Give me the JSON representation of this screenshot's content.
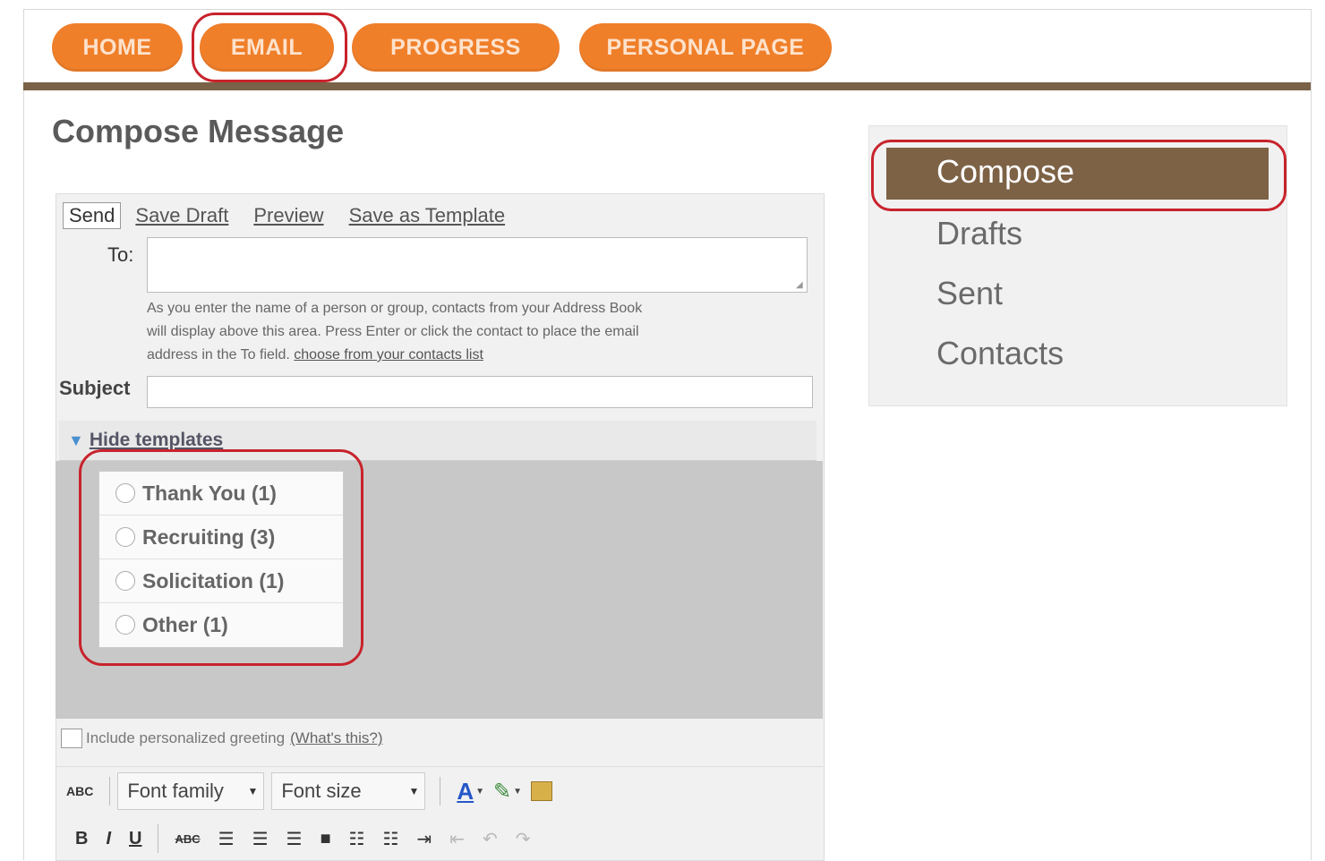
{
  "nav": {
    "tabs": [
      {
        "label": "HOME"
      },
      {
        "label": "EMAIL"
      },
      {
        "label": "PROGRESS"
      },
      {
        "label": "PERSONAL PAGE"
      }
    ]
  },
  "page": {
    "title": "Compose Message"
  },
  "compose": {
    "send": "Send",
    "save_draft": "Save Draft",
    "preview": "Preview",
    "save_template": "Save as Template",
    "to_label": "To:",
    "to_value": "",
    "help_line1": "As you enter the name of a person or group, contacts from your Address Book",
    "help_line2": "will display above this area. Press Enter or click the contact to place the email",
    "help_line3": "address in the To field.",
    "help_link": "choose from your contacts list",
    "subject_label": "Subject",
    "subject_value": ""
  },
  "templates": {
    "toggle": "Hide templates",
    "items": [
      {
        "label": "Thank You (1)"
      },
      {
        "label": "Recruiting (3)"
      },
      {
        "label": "Solicitation (1)"
      },
      {
        "label": "Other (1)"
      }
    ]
  },
  "greeting": {
    "label": "Include personalized greeting",
    "link": "(What's this?)"
  },
  "editor": {
    "spell": "ABC",
    "font_family": "Font family",
    "font_size": "Font size"
  },
  "sidebar": {
    "items": [
      {
        "label": "Compose"
      },
      {
        "label": "Drafts"
      },
      {
        "label": "Sent"
      },
      {
        "label": "Contacts"
      }
    ]
  },
  "colors": {
    "nav_orange": "#f07f2a",
    "brand_brown": "#7a6248",
    "highlight_red": "#c8232c"
  }
}
